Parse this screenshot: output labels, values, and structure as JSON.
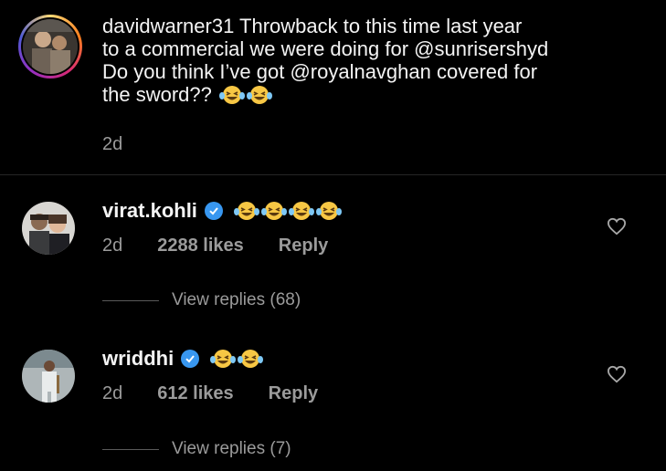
{
  "post": {
    "username": "davidwarner31",
    "caption": "Throwback to this time last year to a commercial we were doing for @sunrisershyd Do you think I’ve got @royalnavghan covered for the sword??",
    "caption_line1": "Throwback to this time last year",
    "caption_line2": "to a commercial we were doing for @sunrisershyd",
    "caption_line3": "Do you think I’ve got @royalnavghan covered for",
    "caption_line4": "the sword??",
    "emoji_count": 2,
    "emoji_name": "face-with-tears-of-joy",
    "time": "2d"
  },
  "comments": [
    {
      "username": "virat.kohli",
      "verified": true,
      "emoji_count": 4,
      "time": "2d",
      "likes": "2288 likes",
      "reply_label": "Reply",
      "view_replies": "View replies (68)"
    },
    {
      "username": "wriddhi",
      "verified": true,
      "emoji_count": 2,
      "time": "2d",
      "likes": "612 likes",
      "reply_label": "Reply",
      "view_replies": "View replies (7)"
    }
  ],
  "colors": {
    "background": "#000000",
    "text": "#f4f4f4",
    "muted": "#9b9b9b",
    "verified": "#3897f0",
    "emoji": "#f7c744"
  },
  "icons": [
    "heart-icon",
    "verified-badge-icon",
    "laughing-emoji-icon"
  ]
}
